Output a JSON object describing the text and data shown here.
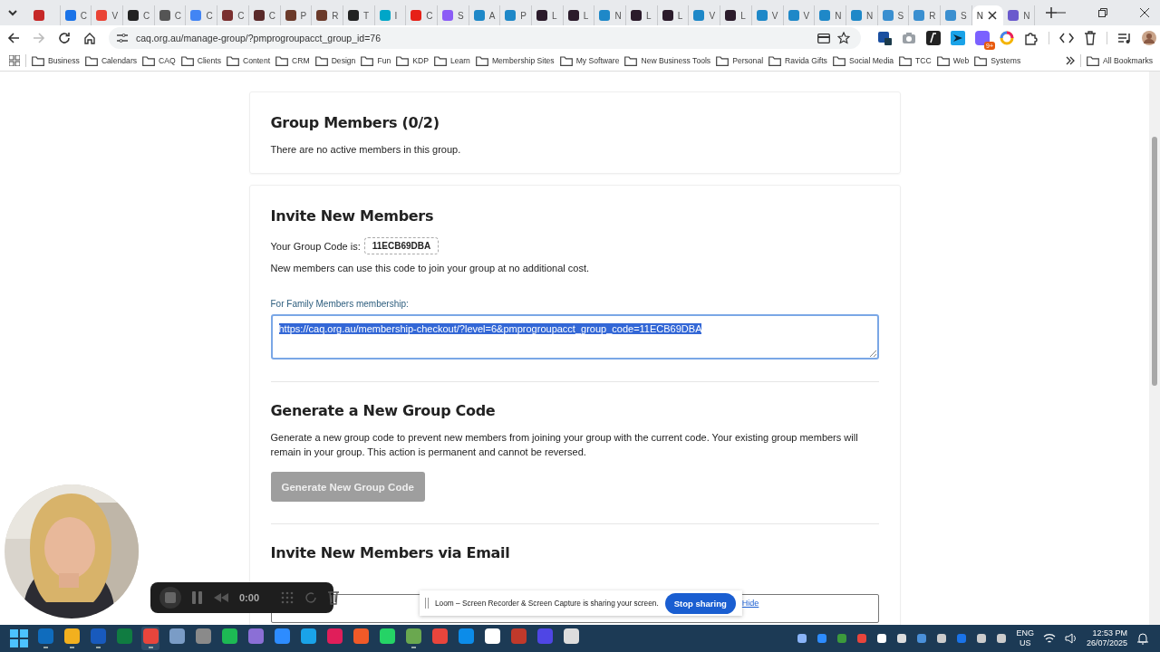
{
  "browser": {
    "tabs": [
      {
        "color": "#c62828",
        "selected": false
      },
      {
        "label": "C",
        "color": "#1a73e8",
        "selected": false
      },
      {
        "label": "V",
        "color": "#ea4335",
        "selected": false
      },
      {
        "label": "C",
        "color": "#222222",
        "selected": false
      },
      {
        "label": "C",
        "color": "#555555",
        "selected": false
      },
      {
        "label": "C",
        "color": "#4285f4",
        "selected": false
      },
      {
        "label": "C",
        "color": "#7a2f2f",
        "selected": false
      },
      {
        "label": "C",
        "color": "#5a2a2a",
        "selected": false
      },
      {
        "label": "P",
        "color": "#6b3a2a",
        "selected": false
      },
      {
        "label": "R",
        "color": "#6b3a2a",
        "selected": false
      },
      {
        "label": "T",
        "color": "#222222",
        "selected": false
      },
      {
        "label": "I",
        "color": "#00a6c8",
        "selected": false
      },
      {
        "label": "C",
        "color": "#e62117",
        "selected": false
      },
      {
        "label": "S",
        "color": "#8b5cf6",
        "selected": false
      },
      {
        "label": "A",
        "color": "#1e88c8",
        "selected": false
      },
      {
        "label": "P",
        "color": "#1e88c8",
        "selected": false
      },
      {
        "label": "L",
        "color": "#2b1b2b",
        "selected": false
      },
      {
        "label": "L",
        "color": "#2b1b2b",
        "selected": false
      },
      {
        "label": "N",
        "color": "#1e88c8",
        "selected": false
      },
      {
        "label": "L",
        "color": "#2b1b2b",
        "selected": false
      },
      {
        "label": "L",
        "color": "#2b1b2b",
        "selected": false
      },
      {
        "label": "V",
        "color": "#1e88c8",
        "selected": false
      },
      {
        "label": "L",
        "color": "#2b1b2b",
        "selected": false
      },
      {
        "label": "V",
        "color": "#1e88c8",
        "selected": false
      },
      {
        "label": "V",
        "color": "#1e88c8",
        "selected": false
      },
      {
        "label": "N",
        "color": "#1e88c8",
        "selected": false
      },
      {
        "label": "N",
        "color": "#1e88c8",
        "selected": false
      },
      {
        "label": "S",
        "color": "#3a8fd0",
        "selected": false
      },
      {
        "label": "R",
        "color": "#3a8fd0",
        "selected": false
      },
      {
        "label": "S",
        "color": "#3a8fd0",
        "selected": false
      },
      {
        "label": "N",
        "selected": true
      },
      {
        "label": "N",
        "color": "#6a5acd",
        "selected": false
      }
    ],
    "forward_disabled": true,
    "url": "caq.org.au/manage-group/?pmprogroupacct_group_id=76",
    "extension_badge": "9+",
    "bookmarks": [
      "Business",
      "Calendars",
      "CAQ",
      "Clients",
      "Content",
      "CRM",
      "Design",
      "Fun",
      "KDP",
      "Learn",
      "Membership Sites",
      "My Software",
      "New Business Tools",
      "Personal",
      "Ravida Gifts",
      "Social Media",
      "TCC",
      "Web",
      "Systems"
    ],
    "all_bookmarks": "All Bookmarks"
  },
  "page": {
    "members": {
      "title": "Group Members (0/2)",
      "text": "There are no active members in this group."
    },
    "invite": {
      "title": "Invite New Members",
      "code_label": "Your Group Code is:",
      "code": "11ECB69DBA",
      "code_note": "New members can use this code to join your group at no additional cost.",
      "link_label": "For Family Members membership:",
      "link": "https://caq.org.au/membership-checkout/?level=6&pmprogroupacct_group_code=11ECB69DBA",
      "link_selected": true
    },
    "regenerate": {
      "title": "Generate a New Group Code",
      "text": "Generate a new group code to prevent new members from joining your group with the current code. Your existing group members will remain in your group. This action is permanent and cannot be reversed.",
      "button": "Generate New Group Code",
      "disabled": true
    },
    "email": {
      "title": "Invite New Members via Email"
    }
  },
  "recorder": {
    "time": "0:00"
  },
  "sharing_banner": {
    "text": "Loom – Screen Recorder & Screen Capture is sharing your screen.",
    "stop": "Stop sharing",
    "hide": "Hide"
  },
  "taskbar": {
    "apps": [
      {
        "color": "#0f6cbd",
        "running": true,
        "selected": false
      },
      {
        "color": "#f2b01e",
        "running": true,
        "selected": false
      },
      {
        "color": "#185abd",
        "running": true,
        "selected": false
      },
      {
        "color": "#107c41",
        "running": false,
        "selected": false
      },
      {
        "color": "#e8453c",
        "running": true,
        "selected": true
      },
      {
        "color": "#7a9cc6",
        "running": false,
        "selected": false
      },
      {
        "color": "#8a8a8a",
        "running": false,
        "selected": false
      },
      {
        "color": "#1db954",
        "running": false,
        "selected": false
      },
      {
        "color": "#8b6fd6",
        "running": false,
        "selected": false
      },
      {
        "color": "#2d8cff",
        "running": false,
        "selected": false
      },
      {
        "color": "#1aa3e8",
        "running": false,
        "selected": false
      },
      {
        "color": "#e01e5a",
        "running": false,
        "selected": false
      },
      {
        "color": "#f05a28",
        "running": false,
        "selected": false
      },
      {
        "color": "#25d366",
        "running": false,
        "selected": false
      },
      {
        "color": "#6aa84f",
        "running": true,
        "selected": false
      },
      {
        "color": "#e8453c",
        "running": false,
        "selected": false
      },
      {
        "color": "#0c8ce9",
        "running": false,
        "selected": false
      },
      {
        "color": "#ffffff",
        "running": false,
        "selected": false
      },
      {
        "color": "#c0392b",
        "running": false,
        "selected": false
      },
      {
        "color": "#4f46e5",
        "running": false,
        "selected": false
      },
      {
        "color": "#dddddd",
        "running": false,
        "selected": false
      }
    ],
    "language": "ENG",
    "region": "US",
    "time": "12:53 PM",
    "date": "26/07/2025"
  }
}
